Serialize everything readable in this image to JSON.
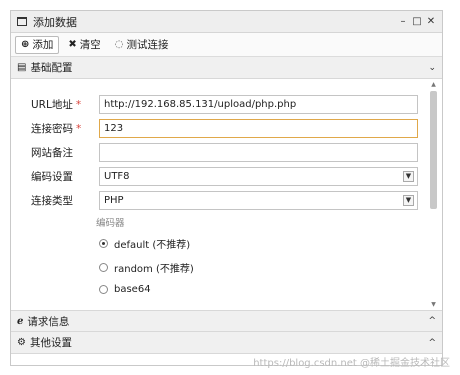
{
  "window": {
    "title": "添加数据",
    "controls": [
      "–",
      "□",
      "✕"
    ]
  },
  "toolbar": {
    "add_label": "添加",
    "clear_label": "清空",
    "test_label": "测试连接"
  },
  "section_basic": {
    "label": "基础配置"
  },
  "form": {
    "url_label": "URL地址",
    "url_value": "http://192.168.85.131/upload/php.php",
    "password_label": "连接密码",
    "password_value": "123",
    "note_label": "网站备注",
    "note_value": "",
    "encoding_label": "编码设置",
    "encoding_value": "UTF8",
    "type_label": "连接类型",
    "type_value": "PHP",
    "required_mark": "*"
  },
  "encoder": {
    "title": "编码器",
    "options": [
      {
        "label": "default (不推荐)",
        "checked": true
      },
      {
        "label": "random (不推荐)",
        "checked": false
      },
      {
        "label": "base64",
        "checked": false
      }
    ]
  },
  "section_request": {
    "label": "请求信息"
  },
  "section_other": {
    "label": "其他设置"
  },
  "watermark": "https://blog.csdn.net @稀土掘金技术社区"
}
